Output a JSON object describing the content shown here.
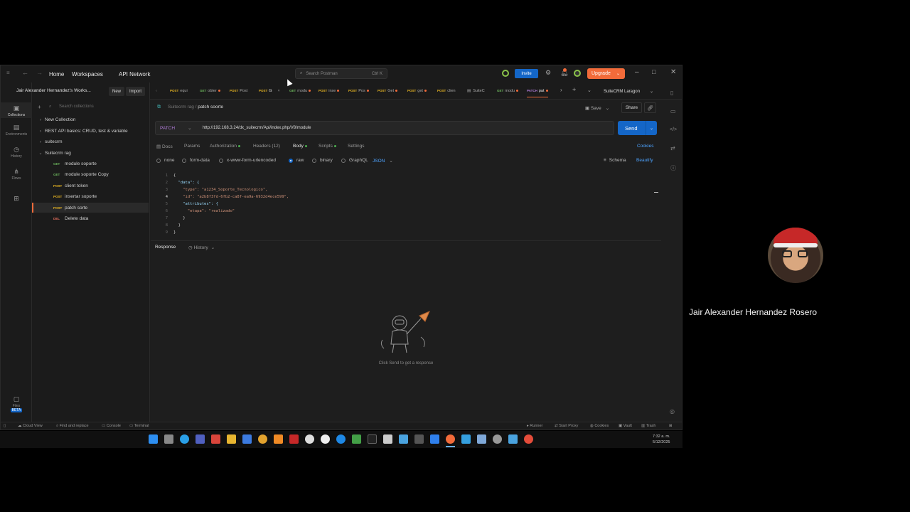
{
  "titlebar": {
    "home": "Home",
    "workspaces": "Workspaces",
    "api_network": "API Network",
    "search_placeholder": "Search Postman",
    "search_shortcut": "Ctrl K",
    "invite": "Invite",
    "upgrade": "Upgrade"
  },
  "sidebar": {
    "workspace_name": "Jair Alexander Hernandez's Works...",
    "new_label": "New",
    "import_label": "Import",
    "search_placeholder": "Search collections",
    "rail": [
      "Collections",
      "Environments",
      "History",
      "Flows",
      "Files",
      "BETA"
    ],
    "tree": [
      {
        "label": "New Collection",
        "level": 0
      },
      {
        "label": "REST API basics: CRUD, test & variable",
        "level": 0
      },
      {
        "label": "suitecrm",
        "level": 0
      },
      {
        "label": "Suitecrm rag",
        "level": 0
      },
      {
        "method": "GET",
        "label": "module soporte",
        "level": 1
      },
      {
        "method": "GET",
        "label": "module soporte Copy",
        "level": 1
      },
      {
        "method": "POST",
        "label": "client token",
        "level": 1
      },
      {
        "method": "POST",
        "label": "insertar soporte",
        "level": 1
      },
      {
        "method": "POST",
        "label": "patch sorte",
        "level": 1
      },
      {
        "method": "DEL",
        "label": "Delete data",
        "level": 1
      }
    ]
  },
  "tabs": [
    {
      "method": "POST",
      "label": "equi"
    },
    {
      "method": "GET",
      "label": "obter"
    },
    {
      "method": "POST",
      "label": "Post"
    },
    {
      "method": "POST",
      "label": "G"
    },
    {
      "method": "GET",
      "label": "modu"
    },
    {
      "method": "POST",
      "label": "inse"
    },
    {
      "method": "POST",
      "label": "Pos"
    },
    {
      "method": "POST",
      "label": "Get"
    },
    {
      "method": "POST",
      "label": "get"
    },
    {
      "method": "POST",
      "label": "clien"
    },
    {
      "method": "",
      "label": "SuiteC"
    },
    {
      "method": "GET",
      "label": "modu"
    },
    {
      "method": "PATCH",
      "label": "pat"
    }
  ],
  "environment": "SuiteCRM Laragon",
  "request": {
    "breadcrumb_parent": "Suitecrm rag",
    "breadcrumb_current": "patch soorte",
    "save": "Save",
    "share": "Share",
    "method": "PATCH",
    "url": "http://192.168.3.24/dx_suitecrm/Api/index.php/V8/module",
    "send": "Send",
    "subtabs": [
      "Docs",
      "Params",
      "Authorization",
      "Headers (12)",
      "Body",
      "Scripts",
      "Settings"
    ],
    "cookies": "Cookies",
    "body_types": [
      "none",
      "form-data",
      "x-www-form-urlencoded",
      "raw",
      "binary",
      "GraphQL"
    ],
    "body_format": "JSON",
    "schema": "Schema",
    "beautify": "Beautify",
    "code_lines": [
      "{",
      "  \"data\": {",
      "    \"type\": \"a1234_Soporte_Tecnologico\",",
      "    \"id\": \"a2b8f3fd-6fb2-ca8f-ea9a-6932d4ece599\",",
      "    \"attributes\": {",
      "      \"etapa\": \"realizado\"",
      "    }",
      "  }",
      "}"
    ]
  },
  "response": {
    "label": "Response",
    "history": "History",
    "empty_text": "Click Send to get a response"
  },
  "statusbar": {
    "left": [
      "Cloud View",
      "Find and replace",
      "Console",
      "Terminal"
    ],
    "right": [
      "Runner",
      "Start Proxy",
      "Cookies",
      "Vault",
      "Trash"
    ]
  },
  "taskbar": {
    "time": "7:32 a. m.",
    "date": "5/12/2025"
  },
  "participant": {
    "name": "Jair Alexander Hernandez Rosero"
  },
  "colors": {
    "accent_blue": "#1466c7",
    "accent_orange": "#f26b3a"
  }
}
